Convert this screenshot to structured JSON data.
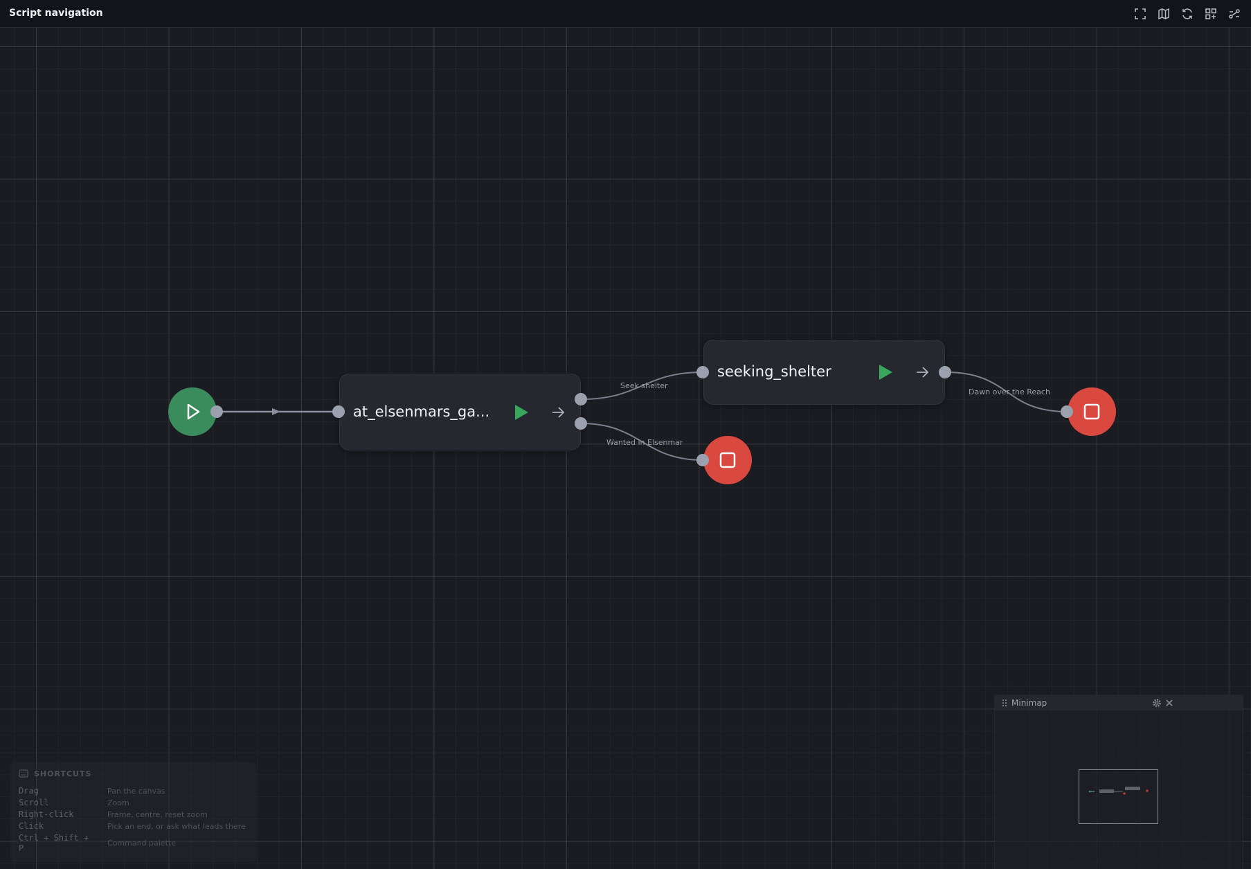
{
  "app": {
    "title": "Script navigation"
  },
  "toolbar": {
    "buttons": [
      {
        "icon": "fullscreen-icon"
      },
      {
        "icon": "map-icon"
      },
      {
        "icon": "refresh-icon"
      },
      {
        "icon": "layout-icon"
      },
      {
        "icon": "connections-icon"
      }
    ]
  },
  "graph": {
    "nodes": {
      "start": {
        "icon": "play-icon",
        "color": "#3a8c5c"
      },
      "scene1": {
        "label": "at_elsenmars_ga..."
      },
      "scene2": {
        "label": "seeking_shelter"
      },
      "end1": {
        "icon": "stop-icon",
        "color": "#d9493f"
      },
      "end2": {
        "icon": "stop-icon",
        "color": "#d9493f"
      }
    },
    "edges": {
      "seek_shelter": "Seek shelter",
      "wanted": "Wanted in Elsenmar",
      "dawn": "Dawn over the Reach"
    }
  },
  "minimap": {
    "title": "Minimap"
  },
  "shortcuts": {
    "title": "SHORTCUTS",
    "items": [
      {
        "key": "Drag",
        "desc": "Pan the canvas"
      },
      {
        "key": "Scroll",
        "desc": "Zoom"
      },
      {
        "key": "Right-click",
        "desc": "Frame, centre, reset zoom"
      },
      {
        "key": "Click",
        "desc": "Pick an end, or ask what leads there"
      },
      {
        "key": "Ctrl + Shift + P",
        "desc": "Command palette"
      }
    ]
  },
  "colors": {
    "accent_green": "#3aa65c",
    "end_red": "#d9493f",
    "port": "#9aa0ad"
  }
}
